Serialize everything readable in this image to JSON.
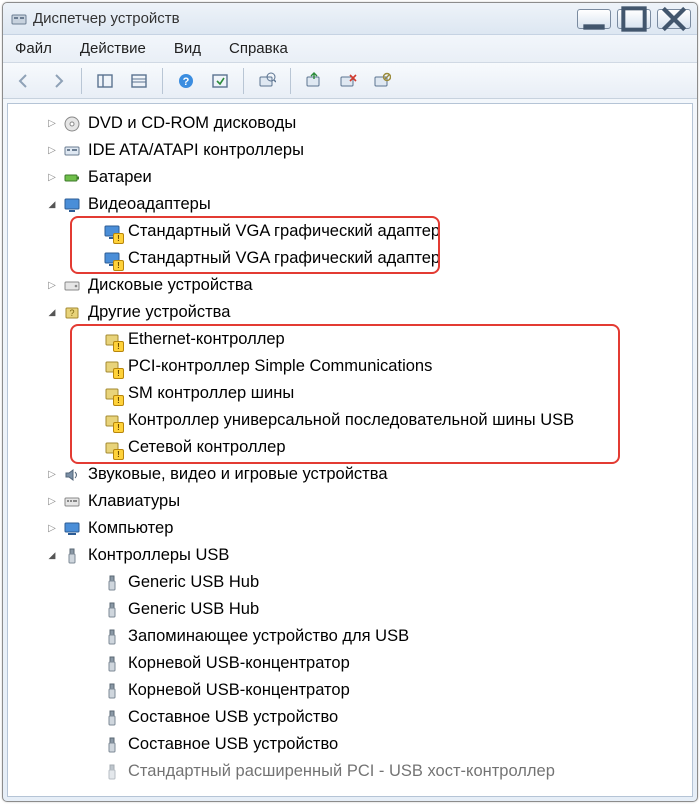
{
  "window": {
    "title": "Диспетчер устройств"
  },
  "menus": {
    "file": "Файл",
    "action": "Действие",
    "view": "Вид",
    "help": "Справка"
  },
  "tree": {
    "n0": "DVD и CD-ROM дисководы",
    "n1": "IDE ATA/ATAPI контроллеры",
    "n2": "Батареи",
    "n3": "Видеоадаптеры",
    "n3a": "Стандартный VGA графический адаптер",
    "n3b": "Стандартный VGA графический адаптер",
    "n4": "Дисковые устройства",
    "n5": "Другие устройства",
    "n5a": "Ethernet-контроллер",
    "n5b": "PCI-контроллер Simple Communications",
    "n5c": "SM контроллер шины",
    "n5d": "Контроллер универсальной последовательной шины USB",
    "n5e": "Сетевой контроллер",
    "n6": "Звуковые, видео и игровые устройства",
    "n7": "Клавиатуры",
    "n8": "Компьютер",
    "n9": "Контроллеры USB",
    "n9a": "Generic USB Hub",
    "n9b": "Generic USB Hub",
    "n9c": "Запоминающее устройство для USB",
    "n9d": "Корневой USB-концентратор",
    "n9e": "Корневой USB-концентратор",
    "n9f": "Составное USB устройство",
    "n9g": "Составное USB устройство",
    "n9h": "Стандартный расширенный PCI - USB хост-контроллер"
  }
}
